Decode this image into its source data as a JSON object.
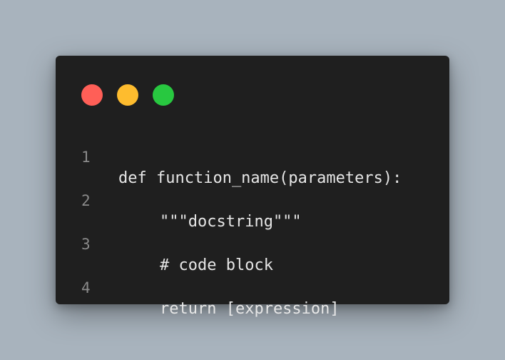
{
  "window": {
    "buttons": [
      {
        "name": "close",
        "color": "#ff5f57"
      },
      {
        "name": "minimize",
        "color": "#febc2e"
      },
      {
        "name": "maximize",
        "color": "#28c840"
      }
    ]
  },
  "code": {
    "lines": [
      {
        "number": "1",
        "text": "def function_name(parameters):"
      },
      {
        "number": "2",
        "text": "\"\"\"docstring\"\"\""
      },
      {
        "number": "3",
        "text": "# code block"
      },
      {
        "number": "4",
        "text": "return [expression]"
      }
    ]
  }
}
